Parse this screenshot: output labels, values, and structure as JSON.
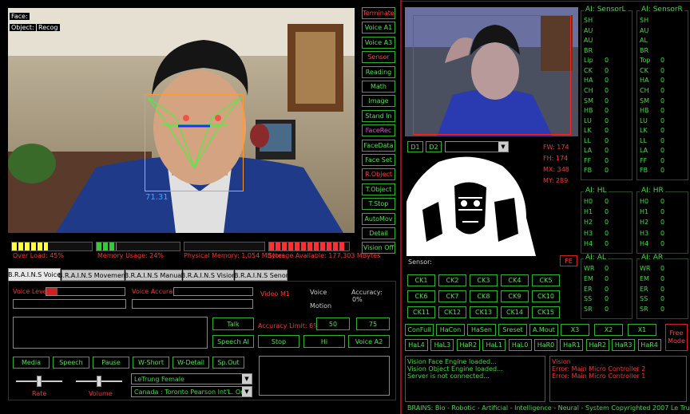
{
  "camera_left": {
    "face_label": "Face:",
    "object_label": "Object:",
    "recog_label": "Recog",
    "face_score": "71.31"
  },
  "meters": [
    {
      "label": "Over Load: 45%",
      "color": "#ffff33",
      "level": 0.45
    },
    {
      "label": "Memory Usage: 24%",
      "color": "#33cc33",
      "level": 0.24
    },
    {
      "label": "Physical Memory: 1,054 MBytes",
      "color": "#666666",
      "level": 0.0
    },
    {
      "label": "Storage Available: 177,303 MBytes",
      "color": "#ff3030",
      "level": 0.95
    }
  ],
  "command_buttons": [
    {
      "label": "Terminate",
      "style": "red"
    },
    {
      "label": "Voice A1",
      "style": ""
    },
    {
      "label": "Voice A3",
      "style": ""
    },
    {
      "label": "Sensor",
      "style": "red"
    },
    {
      "label": "Reading",
      "style": ""
    },
    {
      "label": "Math",
      "style": ""
    },
    {
      "label": "Image",
      "style": ""
    },
    {
      "label": "Stand In",
      "style": ""
    },
    {
      "label": "FaceRec",
      "style": "mag"
    },
    {
      "label": "FaceData",
      "style": ""
    },
    {
      "label": "Face Set",
      "style": ""
    },
    {
      "label": "R.Object",
      "style": "red"
    },
    {
      "label": "T.Object",
      "style": ""
    },
    {
      "label": "T.Stop",
      "style": ""
    },
    {
      "label": "AutoMov",
      "style": ""
    },
    {
      "label": "Detail",
      "style": ""
    },
    {
      "label": "Vision Off",
      "style": ""
    }
  ],
  "tabs": [
    {
      "label": "B.R.A.I.N.S Voice",
      "active": true
    },
    {
      "label": "B.R.A.I.N.S Movement",
      "active": false
    },
    {
      "label": "B.R.A.I.N.S Manual",
      "active": false
    },
    {
      "label": "B.R.A.I.N.S Vision",
      "active": false
    },
    {
      "label": "B.R.A.I.N.S Senor",
      "active": false
    }
  ],
  "voice_panel": {
    "voice_level_label": "Voice Level",
    "voice_accuracy_label": "Voice Accuracy",
    "video_label": "Video M1",
    "voice_label": "Voice",
    "motion_label": "Motion",
    "accuracy_label": "Accuracy:",
    "accuracy_value": "0%",
    "accuracy_limit_label": "Accuracy Limit: 6%",
    "buttons": {
      "talk": "Talk",
      "speech_ai": "Speech AI",
      "stop": "Stop",
      "hi": "Hi",
      "voice_a2": "Voice A2",
      "fifty": "50",
      "seventy_five": "75",
      "media": "Media",
      "speech": "Speech",
      "pause": "Pause",
      "w_short": "W-Short",
      "w_detail": "W-Detail",
      "sp_out": "Sp.Out"
    },
    "rate_label": "Rate",
    "volume_label": "Volume",
    "rate_level": 0.5,
    "volume_level": 0.5,
    "voice_select": "LeTrung Female",
    "location_select": "Canada : Toronto Pearson Int'L. Ont."
  },
  "vision": {
    "d1": "D1",
    "d2": "D2",
    "stats": [
      "FW: 174",
      "FH: 174",
      "MX: 348",
      "MY: 289"
    ],
    "sensor_label": "Sensor:",
    "fe_label": "FE"
  },
  "ck_buttons": [
    "CK1",
    "CK2",
    "CK3",
    "CK4",
    "CK5",
    "CK6",
    "CK7",
    "CK8",
    "CK9",
    "CK10",
    "CK11",
    "CK12",
    "CK13",
    "CK14",
    "CK15"
  ],
  "row1_buttons": [
    "ConFull",
    "HaCon",
    "HaSen",
    "Sreset",
    "A.Mout",
    "X3",
    "X2",
    "X1"
  ],
  "row2_buttons": [
    "HaL4",
    "HaL3",
    "HaR2",
    "HaL1",
    "HaL0",
    "HaR0",
    "HaR1",
    "HaR2",
    "HaR3",
    "HaR4"
  ],
  "free_mode": "Free Mode",
  "sensors": {
    "sensor_l": {
      "title": "AI: SensorL",
      "items": [
        "SH",
        "AU",
        "AU",
        "BR",
        "Lip",
        "CK",
        "HA",
        "CH",
        "SM",
        "HB",
        "LU",
        "LK",
        "LL",
        "LA",
        "FF",
        "FB"
      ],
      "values": [
        "",
        "",
        "",
        "",
        "0",
        "0",
        "0",
        "0",
        "0",
        "0",
        "0",
        "0",
        "0",
        "0",
        "0",
        "0"
      ]
    },
    "sensor_r": {
      "title": "AI: SensorR",
      "items": [
        "SH",
        "AU",
        "AL",
        "BR",
        "Top",
        "CK",
        "HA",
        "CH",
        "SM",
        "HB",
        "LU",
        "LK",
        "LL",
        "LA",
        "FF",
        "FB"
      ],
      "values": [
        "",
        "",
        "",
        "",
        "0",
        "0",
        "0",
        "0",
        "0",
        "0",
        "0",
        "0",
        "0",
        "0",
        "0",
        "0"
      ]
    },
    "hl": {
      "title": "AI: HL",
      "items": [
        "H0",
        "H1",
        "H2",
        "H3",
        "H4"
      ],
      "values": [
        "0",
        "0",
        "0",
        "0",
        "0"
      ]
    },
    "hr": {
      "title": "AI: HR",
      "items": [
        "H0",
        "H1",
        "H2",
        "H3",
        "H4"
      ],
      "values": [
        "0",
        "0",
        "0",
        "0",
        "0"
      ]
    },
    "al": {
      "title": "AI: AL",
      "items": [
        "WR",
        "EM",
        "ER",
        "SS",
        "SR"
      ],
      "values": [
        "0",
        "0",
        "0",
        "0",
        "0"
      ]
    },
    "ar": {
      "title": "AI: AR",
      "items": [
        "WR",
        "EM",
        "ER",
        "SS",
        "SR"
      ],
      "values": [
        "0",
        "0",
        "0",
        "0",
        "0"
      ]
    }
  },
  "log_green": [
    "Vision Face Engine loaded...",
    "Vision Object Engine loaded...",
    "Server is not connected..."
  ],
  "log_red": [
    "Vision",
    "Error: Main Micro Controller 2",
    "Error: Main Micro Controller 1"
  ],
  "footer": "BRAINS: Bio - Robotic - Artificial - Intelligence - Neural - System  Copyrighted  2007 Le Trung"
}
